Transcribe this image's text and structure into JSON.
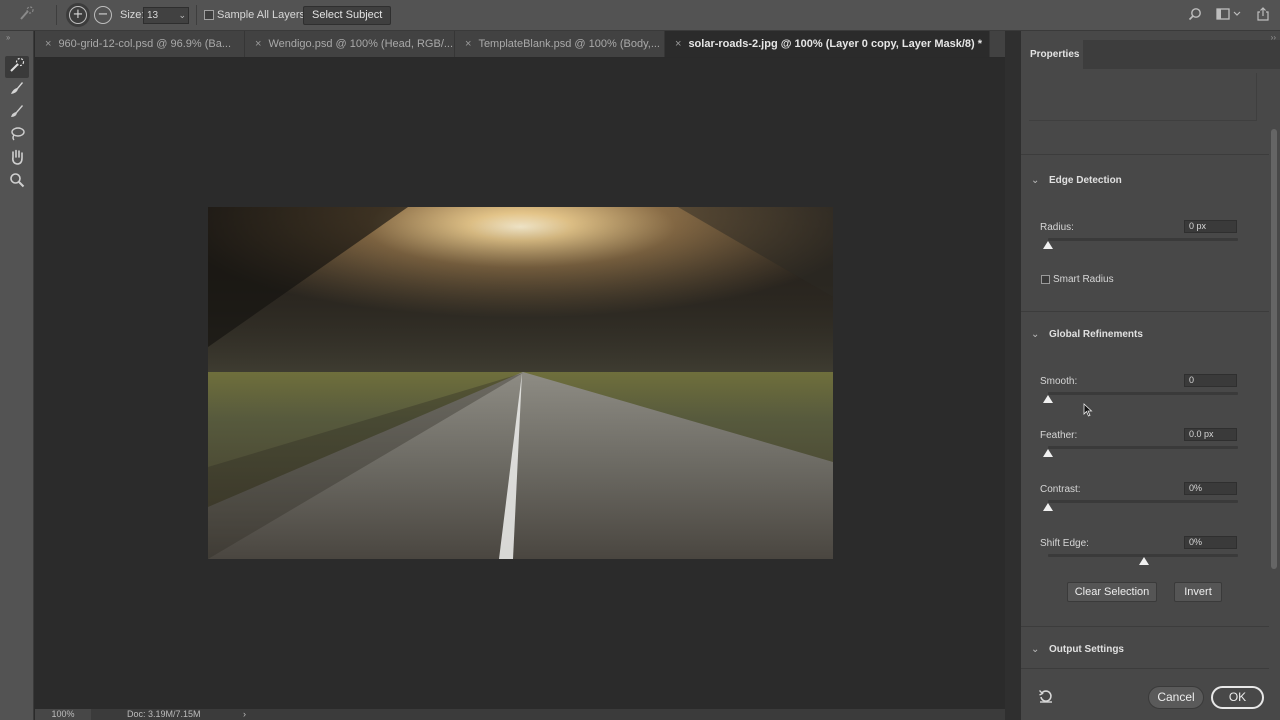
{
  "options_bar": {
    "size_label": "Size:",
    "size_value": "13",
    "sample_all_layers_label": "Sample All Layers",
    "sample_all_layers_checked": false,
    "select_subject_label": "Select Subject"
  },
  "tabs": [
    {
      "label": "960-grid-12-col.psd @ 96.9% (Ba...",
      "active": false
    },
    {
      "label": "Wendigo.psd @ 100% (Head, RGB/...",
      "active": false
    },
    {
      "label": "TemplateBlank.psd @ 100% (Body,...",
      "active": false
    },
    {
      "label": "solar-roads-2.jpg @ 100% (Layer 0 copy, Layer Mask/8) *",
      "active": true
    }
  ],
  "tab_close_glyph": "×",
  "status": {
    "zoom": "100%",
    "doc": "Doc: 3.19M/7.15M",
    "arrow": "›"
  },
  "panel": {
    "title": "Properties",
    "edge_detection": {
      "title": "Edge Detection",
      "radius_label": "Radius:",
      "radius_value": "0 px",
      "radius_level": 0,
      "smart_radius_label": "Smart Radius",
      "smart_radius_checked": false
    },
    "global_refinements": {
      "title": "Global Refinements",
      "smooth_label": "Smooth:",
      "smooth_value": "0",
      "smooth_level": 0,
      "feather_label": "Feather:",
      "feather_value": "0.0 px",
      "feather_level": 0,
      "contrast_label": "Contrast:",
      "contrast_value": "0%",
      "contrast_level": 0,
      "shift_edge_label": "Shift Edge:",
      "shift_edge_value": "0%",
      "shift_edge_level": 0.5
    },
    "clear_selection_label": "Clear Selection",
    "invert_label": "Invert",
    "output_settings": {
      "title": "Output Settings"
    },
    "cancel_label": "Cancel",
    "ok_label": "OK"
  },
  "colors": {
    "options_bar_bg": "#535353",
    "canvas_bg": "#2b2b2b",
    "panel_bg": "#484848",
    "active_tab_text": "#e6e6e6"
  },
  "icons": {
    "tool_preset": "quick-selection-preset-icon",
    "add_to_selection": "add-to-selection-icon",
    "subtract_from_selection": "subtract-from-selection-icon",
    "search": "search-icon",
    "workspace": "workspace-icon",
    "share": "share-icon",
    "tools": [
      "quick-selection-icon",
      "refine-edge-brush-icon",
      "brush-icon",
      "lasso-icon",
      "hand-icon",
      "zoom-icon"
    ],
    "reset": "reset-icon"
  }
}
